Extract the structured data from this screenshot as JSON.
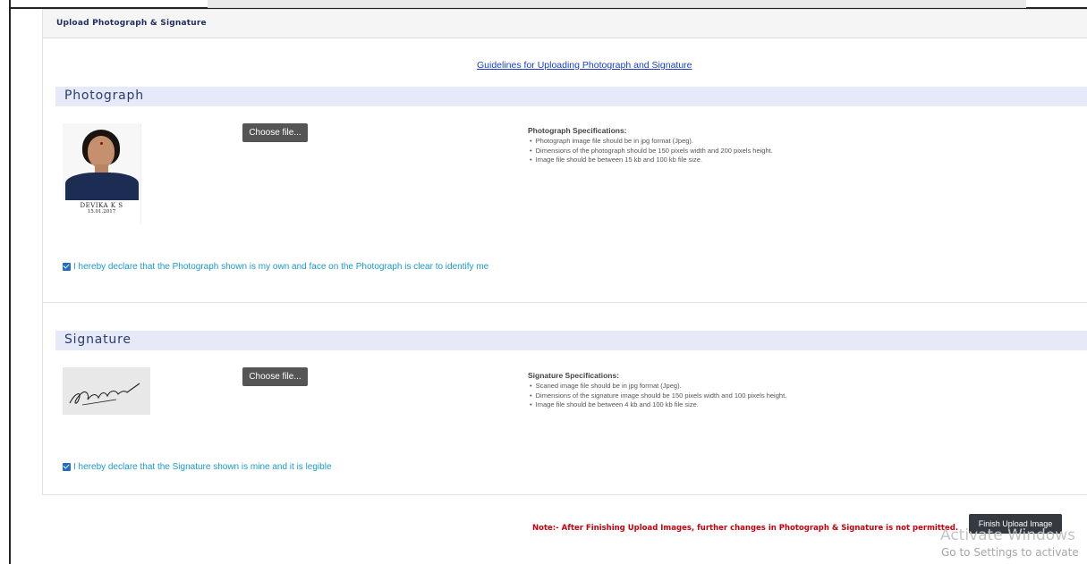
{
  "panel": {
    "title": "Upload Photograph & Signature"
  },
  "guidelines_link": "Guidelines for Uploading Photograph and Signature",
  "photograph": {
    "section_title": "Photograph",
    "image_caption_name": "DEVIKA K S",
    "image_caption_date": "15.01.2017",
    "choose_file_label": "Choose file...",
    "spec_heading": "Photograph Specifications:",
    "specs": [
      "Photograph image file should be in jpg format (Jpeg).",
      "Dimensions of the photograph should be 150 pixels width and 200 pixels height.",
      "Image file should be between 15 kb and 100 kb file size."
    ],
    "declaration": "I hereby declare that the Photograph shown is my own and face on the Photograph is clear to identify me",
    "declaration_checked": true
  },
  "signature": {
    "section_title": "Signature",
    "choose_file_label": "Choose file...",
    "spec_heading": "Signature Specifications:",
    "specs": [
      "Scaned image file should be in jpg format (Jpeg).",
      "Dimensions of the signature image should be 150 pixels width and 100 pixels height.",
      "Image file should be between 4 kb and 100 kb file size."
    ],
    "declaration": "I hereby declare that the Signature shown is mine and it is legible",
    "declaration_checked": true
  },
  "footer": {
    "note": "Note:- After Finishing Upload Images, further changes in Photograph & Signature is not permitted.",
    "finish_button": "Finish Upload Image"
  },
  "watermark": {
    "line1": "Activate Windows",
    "line2": "Go to Settings to activate"
  },
  "colors": {
    "section_bar": "#e5e9f8",
    "link": "#1a3fc9",
    "declaration": "#1a9ac9",
    "note": "#c8000b",
    "button": "#555555"
  }
}
